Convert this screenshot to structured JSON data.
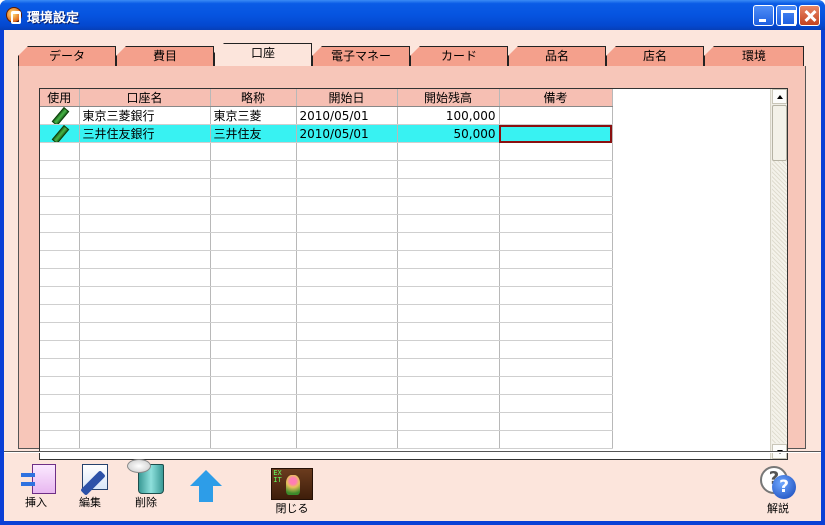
{
  "window": {
    "title": "環境設定"
  },
  "tabs": [
    {
      "label": "データ",
      "active": false
    },
    {
      "label": "費目",
      "active": false
    },
    {
      "label": "口座",
      "active": true
    },
    {
      "label": "電子マネー",
      "active": false
    },
    {
      "label": "カード",
      "active": false
    },
    {
      "label": "品名",
      "active": false
    },
    {
      "label": "店名",
      "active": false
    },
    {
      "label": "環境",
      "active": false
    }
  ],
  "table": {
    "columns": [
      "使用",
      "口座名",
      "略称",
      "開始日",
      "開始残高",
      "備考"
    ],
    "rows": [
      {
        "in_use": "pencil-icon",
        "name": "東京三菱銀行",
        "short": "東京三菱",
        "start": "2010/05/01",
        "balance": "100,000",
        "note": ""
      },
      {
        "in_use": "pencil-icon",
        "name": "三井住友銀行",
        "short": "三井住友",
        "start": "2010/05/01",
        "balance": "50,000",
        "note": ""
      }
    ],
    "selected_row": 1,
    "empty_rows": 17
  },
  "toolbar": {
    "insert": "挿入",
    "edit": "編集",
    "delete": "削除",
    "up_icon": "up-arrow-icon",
    "close": "閉じる",
    "help": "解説"
  }
}
